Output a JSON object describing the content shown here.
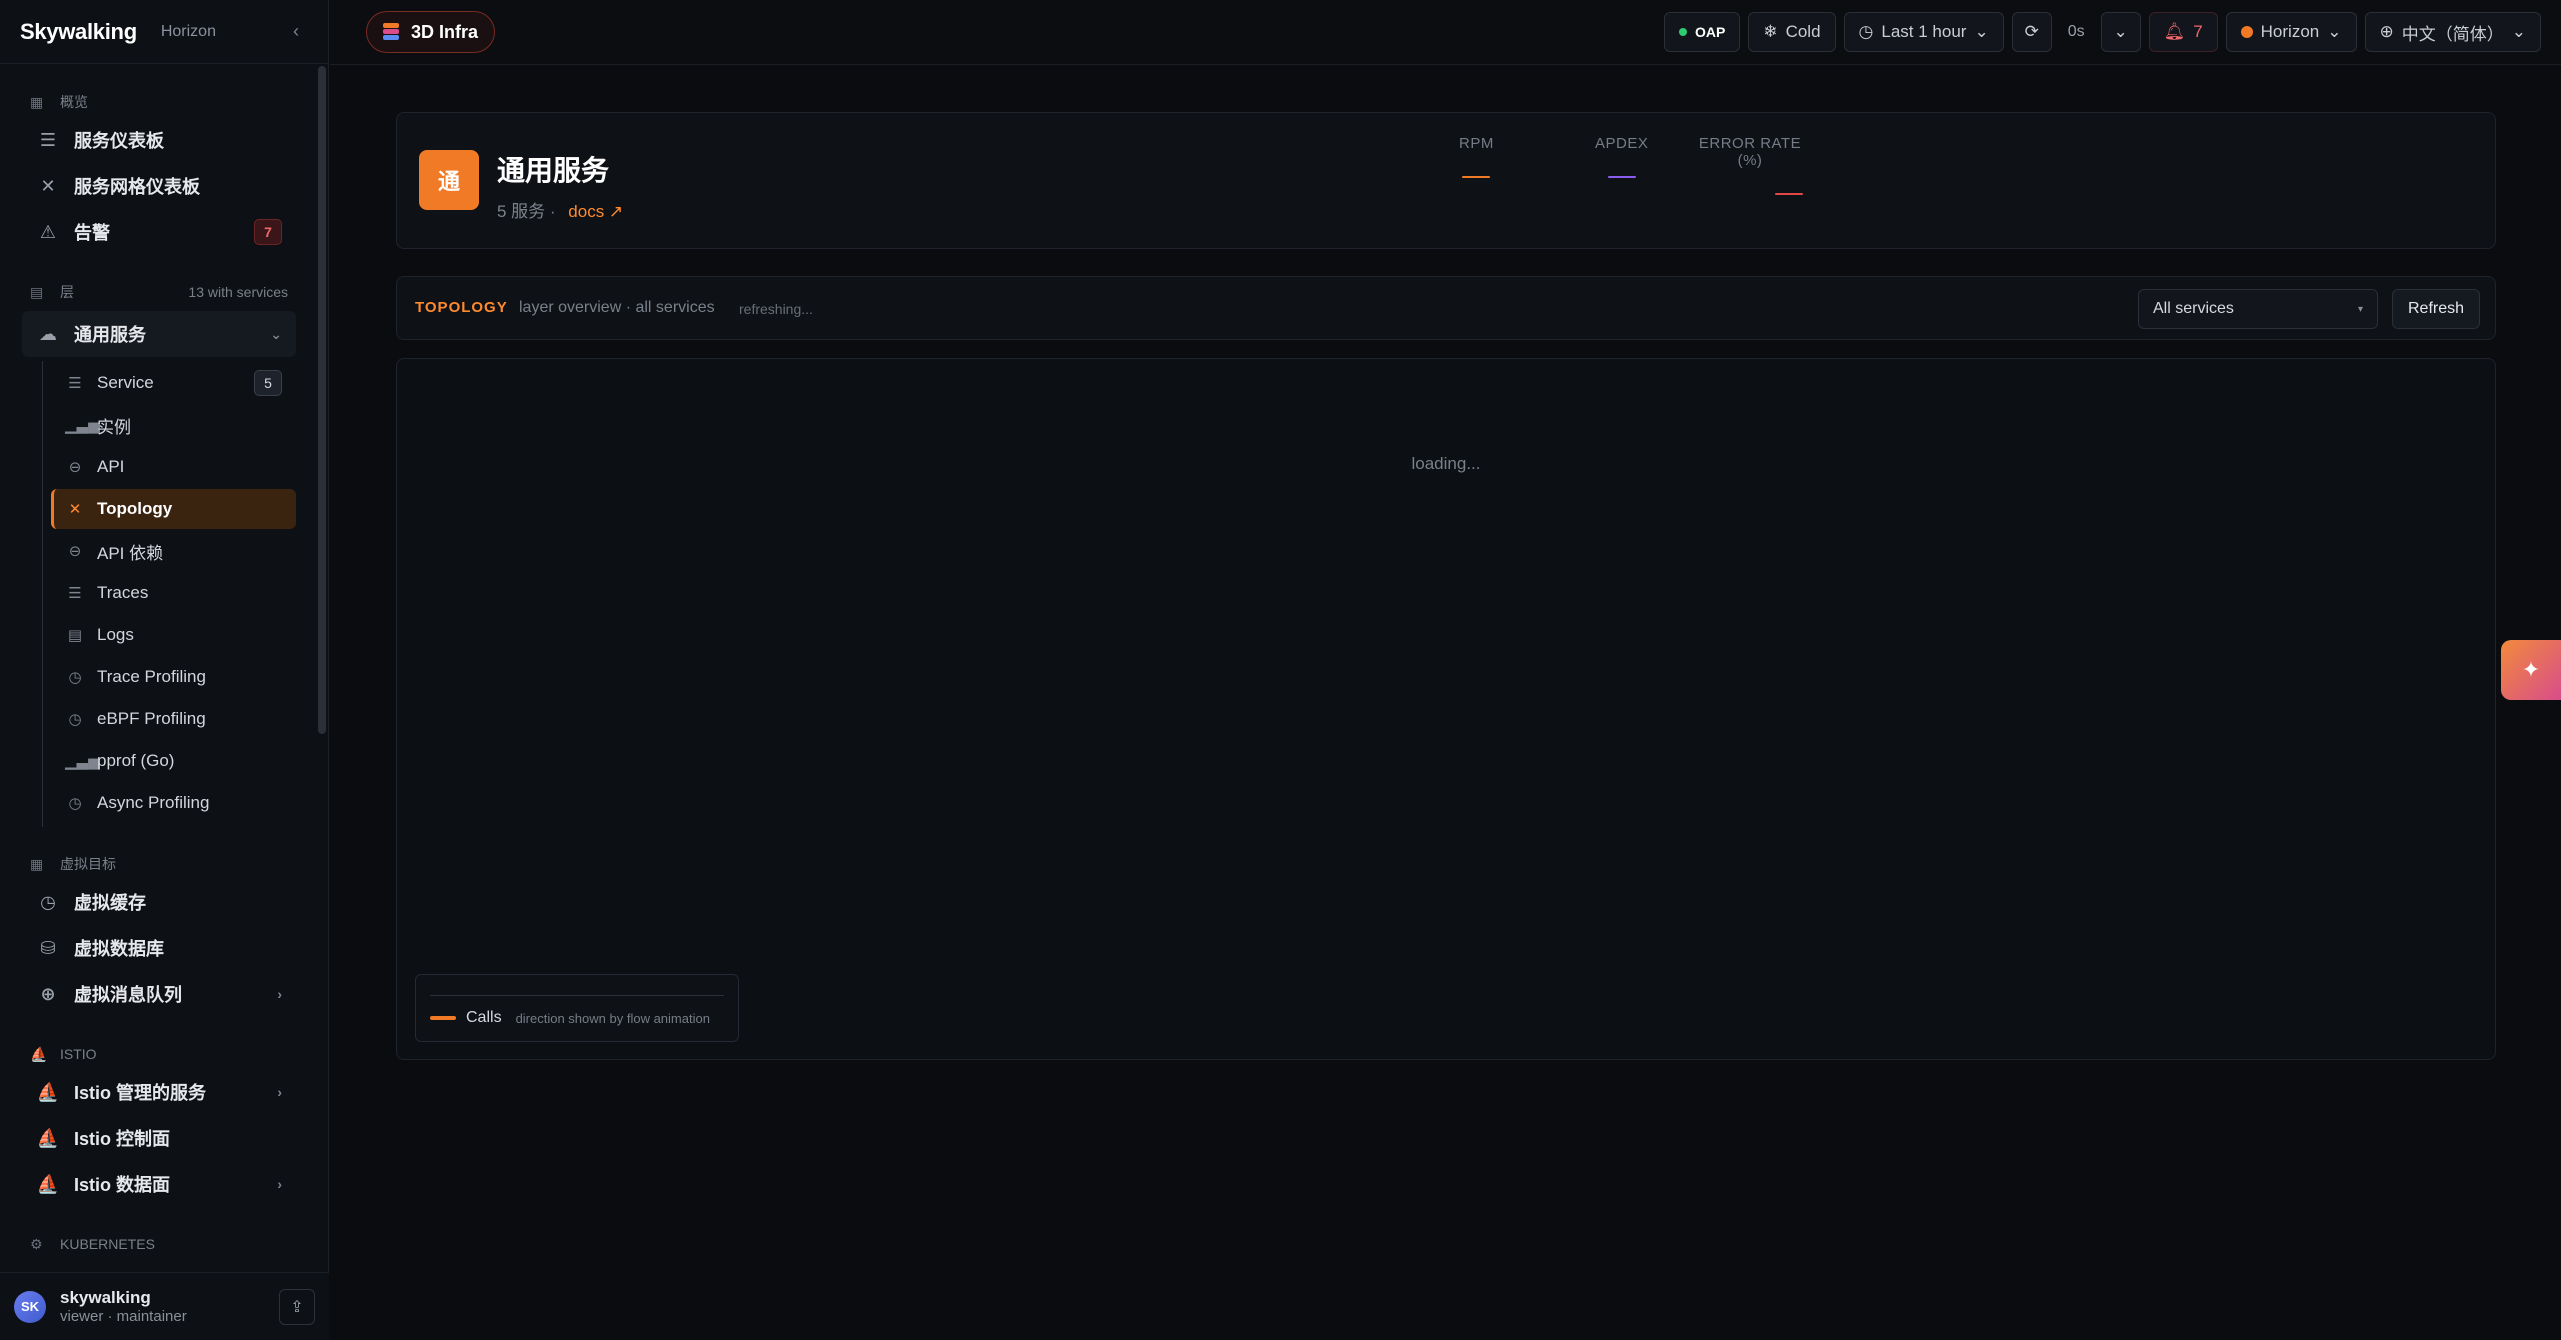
{
  "sidebar": {
    "logo": "Skywalking",
    "theme": "Horizon",
    "overview": {
      "heading": "概览",
      "items": [
        {
          "label": "服务仪表板",
          "icon": "dashboard-icon"
        },
        {
          "label": "服务网格仪表板",
          "icon": "mesh-icon"
        },
        {
          "label": "告警",
          "icon": "alert-icon",
          "badge": "7"
        }
      ]
    },
    "layers": {
      "heading": "层",
      "count_text": "13 with services",
      "active_layer": "通用服务",
      "sub_items": [
        {
          "label": "Service",
          "icon": "list-icon",
          "badge": "5"
        },
        {
          "label": "实例",
          "icon": "bars-icon"
        },
        {
          "label": "API",
          "icon": "endpoint-icon"
        },
        {
          "label": "Topology",
          "icon": "topology-icon",
          "active": true
        },
        {
          "label": "API 依赖",
          "icon": "endpoint-icon"
        },
        {
          "label": "Traces",
          "icon": "traces-icon"
        },
        {
          "label": "Logs",
          "icon": "logs-icon"
        },
        {
          "label": "Trace Profiling",
          "icon": "timer-icon"
        },
        {
          "label": "eBPF Profiling",
          "icon": "timer-icon"
        },
        {
          "label": "pprof (Go)",
          "icon": "bars-icon"
        },
        {
          "label": "Async Profiling",
          "icon": "timer-icon"
        }
      ]
    },
    "virtual": {
      "heading": "虚拟目标",
      "items": [
        {
          "label": "虚拟缓存",
          "icon": "clock-icon"
        },
        {
          "label": "虚拟数据库",
          "icon": "database-icon"
        },
        {
          "label": "虚拟消息队列",
          "icon": "globe-icon"
        }
      ]
    },
    "istio": {
      "heading": "ISTIO",
      "items": [
        {
          "label": "Istio 管理的服务",
          "icon": "sail-icon"
        },
        {
          "label": "Istio 控制面",
          "icon": "sail-icon"
        },
        {
          "label": "Istio 数据面",
          "icon": "sail-icon"
        }
      ]
    },
    "kubernetes": {
      "heading": "KUBERNETES"
    },
    "user": {
      "initials": "SK",
      "name": "skywalking",
      "role": "viewer · maintainer"
    }
  },
  "topbar": {
    "infra_label": "3D Infra",
    "oap_label": "OAP",
    "cold_label": "Cold",
    "time_range": "Last 1 hour",
    "interval": "0s",
    "alerts": "7",
    "theme": "Horizon",
    "language": "中文（简体）"
  },
  "hero": {
    "avatar_char": "通",
    "title": "通用服务",
    "sub_count": "5 服务 ·",
    "docs_link": "docs ↗",
    "metrics": [
      {
        "label": "RPM",
        "color": "#f07a26"
      },
      {
        "label": "APDEX",
        "color": "#8a5cf0"
      },
      {
        "label": "ERROR RATE (%)",
        "color": "#e04848"
      }
    ]
  },
  "topology": {
    "label": "TOPOLOGY",
    "description": "layer overview · all services",
    "status": "refreshing...",
    "select_value": "All services",
    "refresh_label": "Refresh",
    "loading_text": "loading...",
    "legend": {
      "name": "Calls",
      "note": "direction shown by flow animation",
      "color": "#f07a26"
    }
  },
  "colors": {
    "accent": "#f07a26",
    "background": "#0b0d11"
  }
}
